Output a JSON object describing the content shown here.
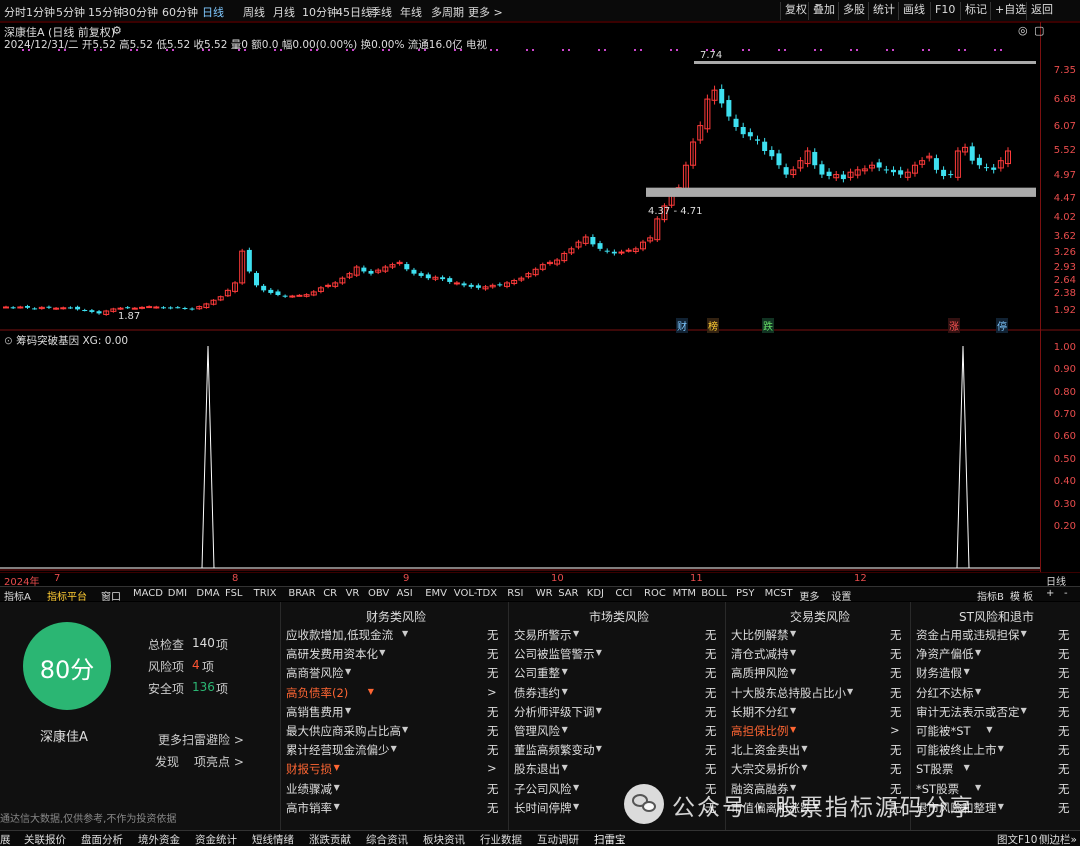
{
  "toolbar": {
    "periods": [
      "分时",
      "1分钟",
      "5分钟",
      "15分钟",
      "30分钟",
      "60分钟",
      "日线",
      "周线",
      "月线",
      "10分钟",
      "45日线",
      "季线",
      "年线",
      "多周期",
      "更多 >"
    ],
    "active_period": "日线",
    "right_buttons": [
      "复权",
      "叠加",
      "多股",
      "统计",
      "画线",
      "F10",
      "标记",
      "+自选",
      "返回"
    ]
  },
  "stock": {
    "title": "深康佳A (日线 前复权)",
    "info": "2024/12/31/二 开5.52 高5.52 低5.52 收5.52 量0 额0.0 幅0.00(0.00%) 换0.00% 流通16.0亿 电视"
  },
  "price_axis": [
    "7.35",
    "6.68",
    "6.07",
    "5.52",
    "4.97",
    "4.47",
    "4.02",
    "3.62",
    "3.26",
    "2.93",
    "2.64",
    "2.38",
    "1.92"
  ],
  "annotations": {
    "low": "1.87",
    "high": "7.74",
    "box_range": "4.37 - 4.71"
  },
  "event_markers": [
    "财",
    "榜",
    "跌",
    "涨",
    "停"
  ],
  "indicator": {
    "title": "筹码突破基因 XG: 0.00",
    "axis": [
      "1.00",
      "0.90",
      "0.80",
      "0.70",
      "0.60",
      "0.50",
      "0.40",
      "0.30",
      "0.20"
    ]
  },
  "time_axis": {
    "year": "2024年",
    "months": [
      "7",
      "8",
      "9",
      "10",
      "11",
      "12"
    ],
    "right": "日线"
  },
  "indicator_tabs": [
    "指标A",
    "指标平台",
    "窗口",
    "MACD",
    "DMI",
    "DMA",
    "FSL",
    "TRIX",
    "BRAR",
    "CR",
    "VR",
    "OBV",
    "ASI",
    "EMV",
    "VOL-TDX",
    "RSI",
    "WR",
    "SAR",
    "KDJ",
    "CCI",
    "ROC",
    "MTM",
    "BOLL",
    "PSY",
    "MCST",
    "更多",
    "设置"
  ],
  "indicator_tabs_right": [
    "指标B",
    "模",
    "板",
    "+",
    "-"
  ],
  "score": {
    "value": "80分",
    "color": "#2bb673",
    "name": "深康佳A",
    "total_label": "总检查",
    "total": "140",
    "unit": "项",
    "risk_label": "风险项",
    "risk": "4",
    "safe_label": "安全项",
    "safe": "136",
    "more": "更多扫雷避险 >",
    "discover": "发现",
    "highlights": "项亮点 >"
  },
  "columns": [
    {
      "title": "财务类风险",
      "rows": [
        {
          "label": "应收款增加,低现金流",
          "val": "无",
          "warn": false
        },
        {
          "label": "高研发费用资本化",
          "val": "无",
          "warn": false
        },
        {
          "label": "高商誉风险",
          "val": "无",
          "warn": false
        },
        {
          "label": "高负债率(2)",
          "val": ">",
          "warn": true
        },
        {
          "label": "高销售费用",
          "val": "无",
          "warn": false
        },
        {
          "label": "最大供应商采购占比高",
          "val": "无",
          "warn": false
        },
        {
          "label": "累计经营现金流偏少",
          "val": "无",
          "warn": false
        },
        {
          "label": "财报亏损",
          "val": ">",
          "warn": true
        },
        {
          "label": "业绩骤减",
          "val": "无",
          "warn": false
        },
        {
          "label": "高市销率",
          "val": "无",
          "warn": false
        }
      ]
    },
    {
      "title": "市场类风险",
      "rows": [
        {
          "label": "交易所警示",
          "val": "无",
          "warn": false
        },
        {
          "label": "公司被监管警示",
          "val": "无",
          "warn": false
        },
        {
          "label": "公司重整",
          "val": "无",
          "warn": false
        },
        {
          "label": "债券违约",
          "val": "无",
          "warn": false
        },
        {
          "label": "分析师评级下调",
          "val": "无",
          "warn": false
        },
        {
          "label": "管理风险",
          "val": "无",
          "warn": false
        },
        {
          "label": "董监高频繁变动",
          "val": "无",
          "warn": false
        },
        {
          "label": "股东退出",
          "val": "无",
          "warn": false
        },
        {
          "label": "子公司风险",
          "val": "无",
          "warn": false
        },
        {
          "label": "长时间停牌",
          "val": "无",
          "warn": false
        }
      ]
    },
    {
      "title": "交易类风险",
      "rows": [
        {
          "label": "大比例解禁",
          "val": "无",
          "warn": false
        },
        {
          "label": "清仓式减持",
          "val": "无",
          "warn": false
        },
        {
          "label": "高质押风险",
          "val": "无",
          "warn": false
        },
        {
          "label": "十大股东总持股占比小",
          "val": "无",
          "warn": false
        },
        {
          "label": "长期不分红",
          "val": "无",
          "warn": false
        },
        {
          "label": "高担保比例",
          "val": ">",
          "warn": true
        },
        {
          "label": "北上资金卖出",
          "val": "无",
          "warn": false
        },
        {
          "label": "大宗交易折价",
          "val": "无",
          "warn": false
        },
        {
          "label": "融资高融券",
          "val": "无",
          "warn": false
        },
        {
          "label": "市值偏离和涨跌",
          "val": "无",
          "warn": false
        }
      ]
    },
    {
      "title": "ST风险和退市",
      "rows": [
        {
          "label": "资金占用或违规担保",
          "val": "无",
          "warn": false
        },
        {
          "label": "净资产偏低",
          "val": "无",
          "warn": false
        },
        {
          "label": "财务造假",
          "val": "无",
          "warn": false
        },
        {
          "label": "分红不达标",
          "val": "无",
          "warn": false
        },
        {
          "label": "审计无法表示或否定",
          "val": "无",
          "warn": false
        },
        {
          "label": "可能被*ST",
          "val": "无",
          "warn": false
        },
        {
          "label": "可能被终止上市",
          "val": "无",
          "warn": false
        },
        {
          "label": "ST股票",
          "val": "无",
          "warn": false
        },
        {
          "label": "*ST股票",
          "val": "无",
          "warn": false
        },
        {
          "label": "退市风险和整理",
          "val": "无",
          "warn": false
        }
      ]
    }
  ],
  "disclaimer": "通达信大数据,仅供参考,不作为投资依据",
  "watermark": "公众号 · 股票指标源码分享",
  "bottom_tabs": [
    "展",
    "关联报价",
    "盘面分析",
    "境外资金",
    "资金统计",
    "短线情绪",
    "涨跌贡献",
    "综合资讯",
    "板块资讯",
    "行业数据",
    "互动调研",
    "扫雷宝"
  ],
  "bottom_right": [
    "图文F10",
    "侧边栏»"
  ],
  "chart_data": {
    "type": "candlestick",
    "title": "深康佳A (日线 前复权)",
    "x_range": [
      "2024-06",
      "2024-12-31"
    ],
    "ylim": [
      1.87,
      7.74
    ],
    "y_scale": "log",
    "close_series": [
      2.02,
      2.0,
      2.02,
      2.0,
      1.98,
      2.01,
      2.0,
      1.99,
      2.0,
      2.0,
      1.96,
      1.94,
      1.9,
      1.87,
      1.92,
      1.97,
      1.99,
      2.0,
      1.99,
      2.01,
      2.03,
      2.02,
      2.0,
      1.99,
      2.01,
      1.98,
      1.96,
      2.03,
      2.1,
      2.2,
      2.3,
      2.45,
      2.6,
      3.3,
      2.85,
      2.55,
      2.45,
      2.4,
      2.35,
      2.3,
      2.32,
      2.34,
      2.36,
      2.42,
      2.5,
      2.55,
      2.6,
      2.7,
      2.8,
      2.95,
      2.85,
      2.8,
      2.88,
      2.95,
      3.0,
      3.05,
      2.9,
      2.8,
      2.75,
      2.7,
      2.72,
      2.68,
      2.62,
      2.6,
      2.55,
      2.52,
      2.5,
      2.52,
      2.55,
      2.56,
      2.6,
      2.65,
      2.7,
      2.8,
      2.9,
      3.0,
      3.05,
      3.1,
      3.25,
      3.35,
      3.5,
      3.62,
      3.45,
      3.35,
      3.3,
      3.25,
      3.28,
      3.32,
      3.35,
      3.5,
      3.6,
      4.0,
      4.3,
      4.6,
      4.71,
      5.2,
      5.72,
      6.1,
      6.7,
      6.9,
      6.6,
      6.3,
      6.07,
      5.9,
      5.85,
      5.75,
      5.52,
      5.4,
      5.2,
      5.0,
      5.1,
      5.3,
      5.52,
      5.2,
      5.0,
      4.97,
      5.0,
      4.9,
      5.05,
      5.1,
      5.12,
      5.2,
      5.15,
      5.1,
      5.05,
      5.0,
      5.05,
      5.2,
      5.3,
      5.4,
      5.1,
      4.97,
      5.0,
      5.52,
      5.6,
      5.3,
      5.2,
      5.15,
      5.1,
      5.3,
      5.52
    ],
    "range_box": [
      4.37,
      4.71
    ],
    "indicator_XG_signals": [
      "2024-07-26",
      "2024-12-25"
    ]
  }
}
